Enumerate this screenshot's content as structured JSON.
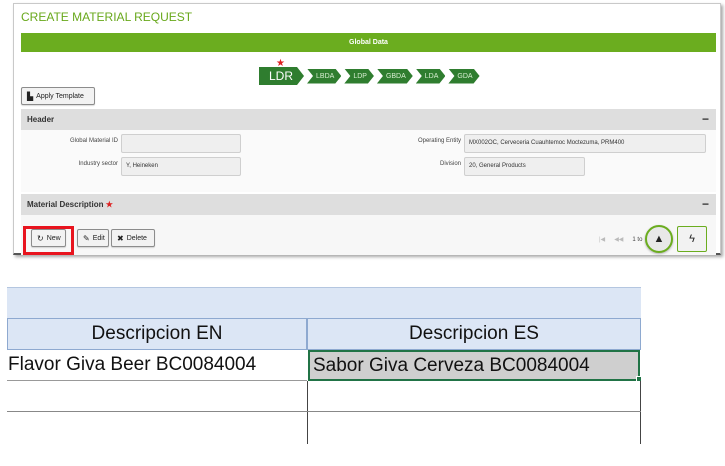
{
  "app": {
    "title": "CREATE MATERIAL REQUEST",
    "global_bar": "Global Data",
    "breadcrumbs": [
      "LDR",
      "LBDA",
      "LDP",
      "GBDA",
      "LDA",
      "GDA"
    ],
    "apply_template": "Apply Template",
    "header_section": "Header",
    "fields": {
      "global_material_id_label": "Global Material ID",
      "global_material_id_value": "",
      "industry_sector_label": "Industry sector",
      "industry_sector_value": "Y, Heineken",
      "operating_entity_label": "Operating Entity",
      "operating_entity_value": "MX002OC, Cerveceria Cuauhtemoc Moctezuma, PRM400",
      "division_label": "Division",
      "division_value": "20, General Products"
    },
    "description_section": "Material Description",
    "actions": {
      "new": "New",
      "edit": "Edit",
      "delete": "Delete"
    },
    "pager": {
      "first": "|◀",
      "prev": "◀◀",
      "count": "1 to"
    },
    "collapse_symbol": "−",
    "icons": [
      "star-icon",
      "apply-template-icon",
      "refresh-icon",
      "edit-icon",
      "close-icon",
      "chevron-up-icon",
      "bolt-icon"
    ],
    "colors": {
      "accent_green": "#6bad1f",
      "breadcrumb_green": "#2f7d2f",
      "highlight_red": "#e8141e"
    }
  },
  "sheet": {
    "headers": [
      "Descripcion EN",
      "Descripcion ES"
    ],
    "rows": [
      [
        "Flavor Giva Beer BC0084004",
        "Sabor Giva Cerveza BC0084004"
      ]
    ]
  }
}
